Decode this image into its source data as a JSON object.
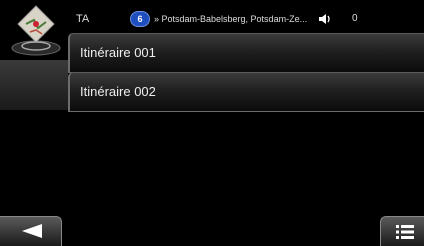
{
  "status_bar": {
    "ta_label": "TA",
    "route_number": "6",
    "route_text": "» Potsdam-Babelsberg, Potsdam-Ze...",
    "volume": "0"
  },
  "routes": {
    "items": [
      {
        "label": "Itinéraire 001"
      },
      {
        "label": "Itinéraire 002"
      }
    ]
  },
  "icons": {
    "app": "map-icon",
    "speaker": "speaker-icon",
    "back": "back-arrow-icon",
    "menu": "menu-icon"
  },
  "colors": {
    "background": "#000000",
    "badge": "#1f4fbf",
    "item_text": "#eeeeee"
  }
}
